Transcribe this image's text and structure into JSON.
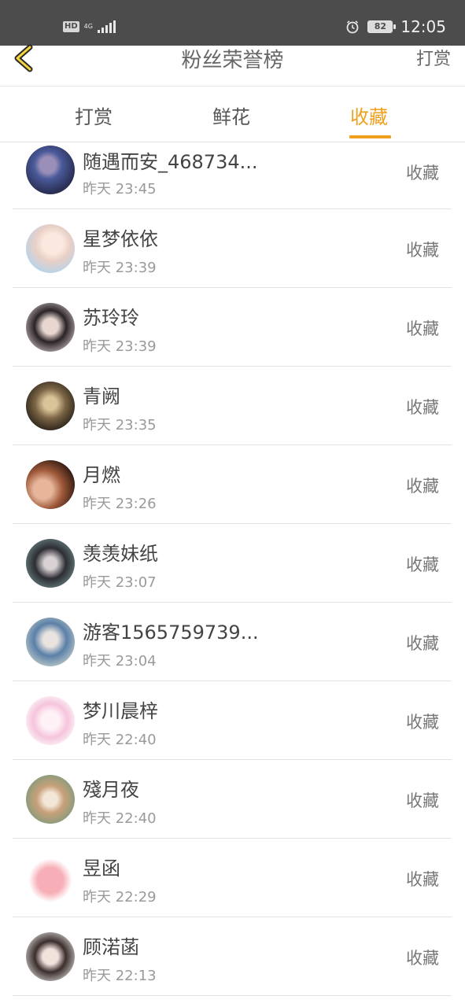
{
  "status_bar": {
    "hd": "HD",
    "network": "4G",
    "battery": "82",
    "time": "12:05"
  },
  "nav": {
    "title": "粉丝荣誉榜",
    "action": "打赏",
    "back_icon": "chevron-left-icon"
  },
  "tabs": [
    {
      "label": "打赏",
      "active": false
    },
    {
      "label": "鲜花",
      "active": false
    },
    {
      "label": "收藏",
      "active": true
    }
  ],
  "accent_color": "#f0a01e",
  "list": [
    {
      "name": "随遇而安_468734...",
      "time": "昨天 23:45",
      "action": "收藏"
    },
    {
      "name": "星梦依依",
      "time": "昨天 23:39",
      "action": "收藏"
    },
    {
      "name": "苏玲玲",
      "time": "昨天 23:39",
      "action": "收藏"
    },
    {
      "name": "青阙",
      "time": "昨天 23:35",
      "action": "收藏"
    },
    {
      "name": "月燃",
      "time": "昨天 23:26",
      "action": "收藏"
    },
    {
      "name": "羡羡妹纸",
      "time": "昨天 23:07",
      "action": "收藏"
    },
    {
      "name": "游客1565759739...",
      "time": "昨天 23:04",
      "action": "收藏"
    },
    {
      "name": "梦川晨梓",
      "time": "昨天 22:40",
      "action": "收藏"
    },
    {
      "name": "殘月夜",
      "time": "昨天 22:40",
      "action": "收藏"
    },
    {
      "name": "昱函",
      "time": "昨天 22:29",
      "action": "收藏"
    },
    {
      "name": "顾渃菡",
      "time": "昨天 22:13",
      "action": "收藏"
    }
  ]
}
